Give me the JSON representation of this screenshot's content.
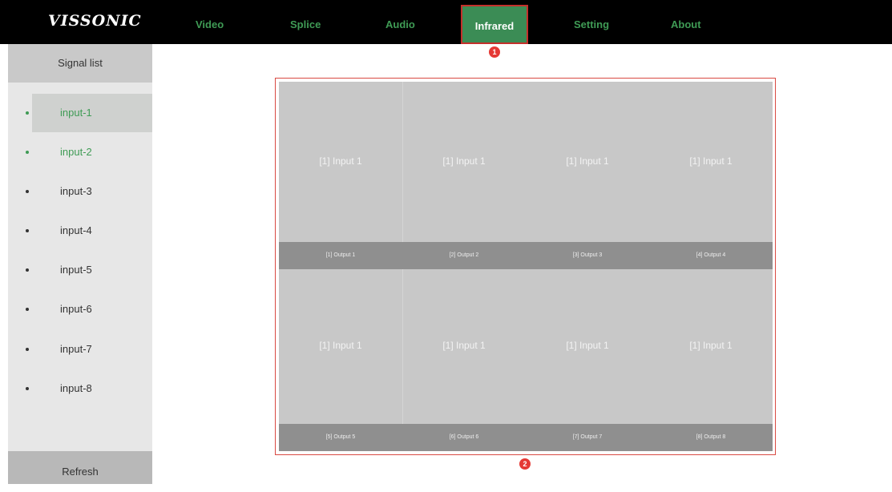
{
  "brand": "VISSONIC",
  "nav": {
    "items": [
      {
        "label": "Video"
      },
      {
        "label": "Splice"
      },
      {
        "label": "Audio"
      },
      {
        "label": "Infrared",
        "active": true
      },
      {
        "label": "Setting"
      },
      {
        "label": "About"
      }
    ]
  },
  "badges": {
    "one": "1",
    "two": "2"
  },
  "sidebar": {
    "header": "Signal list",
    "items": [
      {
        "label": "input-1"
      },
      {
        "label": "input-2"
      },
      {
        "label": "input-3"
      },
      {
        "label": "input-4"
      },
      {
        "label": "input-5"
      },
      {
        "label": "input-6"
      },
      {
        "label": "input-7"
      },
      {
        "label": "input-8"
      }
    ],
    "refresh": "Refresh"
  },
  "grid": {
    "cells": [
      {
        "input": "[1] Input 1",
        "output": "[1] Output 1"
      },
      {
        "input": "[1] Input 1",
        "output": "[2] Output 2"
      },
      {
        "input": "[1] Input 1",
        "output": "[3] Output 3"
      },
      {
        "input": "[1] Input 1",
        "output": "[4] Output 4"
      },
      {
        "input": "[1] Input 1",
        "output": "[5] Output 5"
      },
      {
        "input": "[1] Input 1",
        "output": "[6] Output 6"
      },
      {
        "input": "[1] Input 1",
        "output": "[7] Output 7"
      },
      {
        "input": "[1] Input 1",
        "output": "[8] Output 8"
      }
    ]
  },
  "colors": {
    "accent": "#3b8c55",
    "highlight": "#c4302b"
  }
}
